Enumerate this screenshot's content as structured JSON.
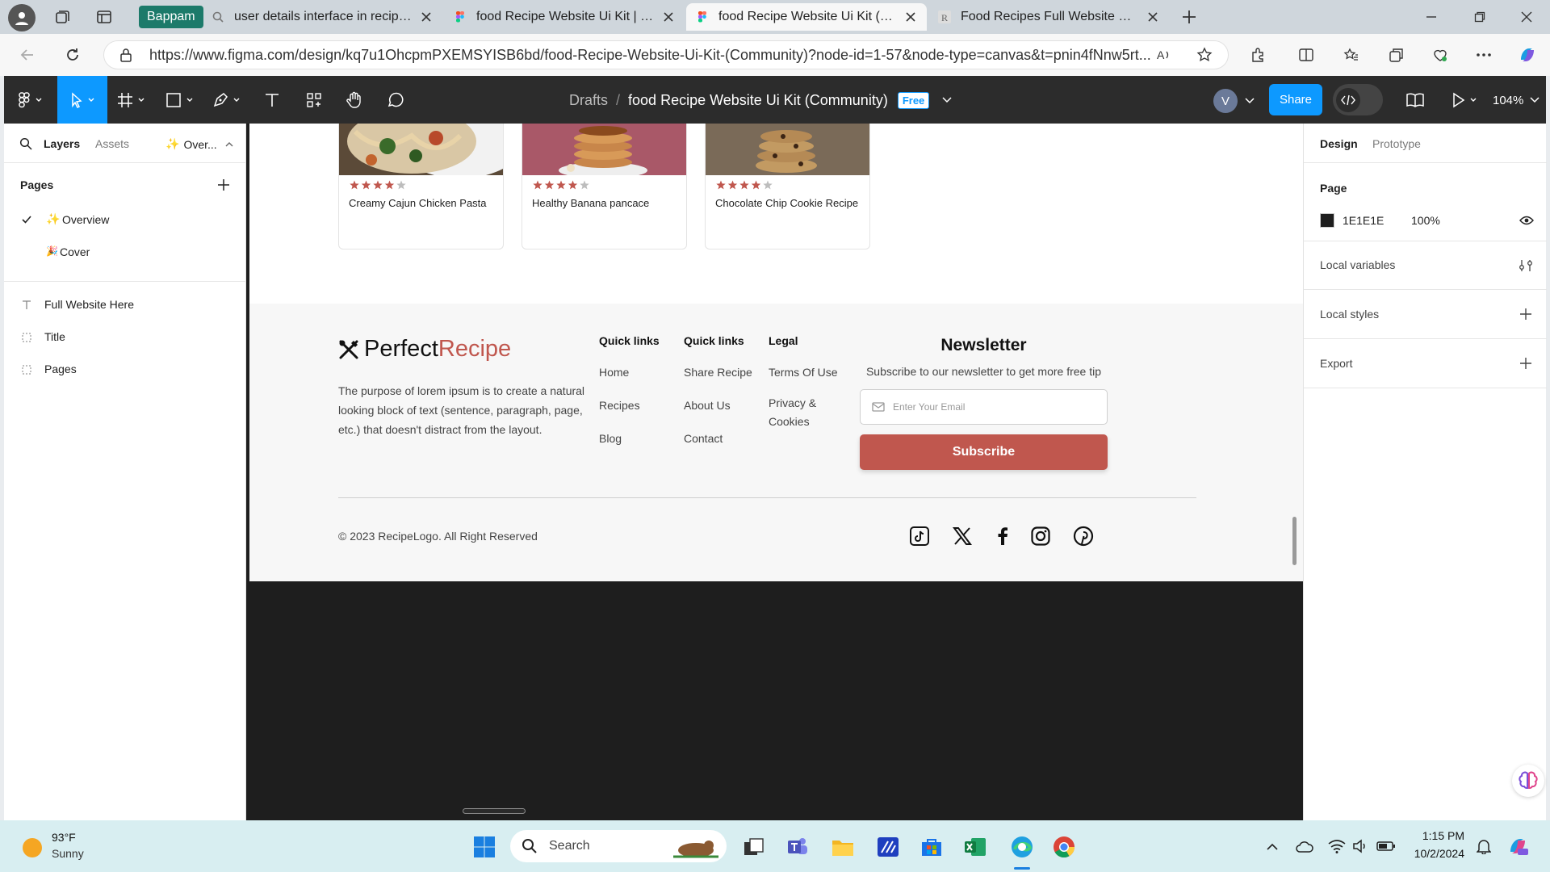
{
  "browser": {
    "tabs": [
      {
        "label": "Bappam",
        "kind": "group"
      },
      {
        "label": "user details interface in recipe we",
        "icon": "search-icon"
      },
      {
        "label": "food Recipe Website Ui Kit | Figma",
        "icon": "figma-icon"
      },
      {
        "label": "food Recipe Website Ui Kit (Comm",
        "icon": "figma-icon",
        "active": true
      },
      {
        "label": "Food Recipes Full Website UI Kit F",
        "icon": "r-icon"
      }
    ],
    "url": "https://www.figma.com/design/kq7u1OhcpmPXEMSYISB6bd/food-Recipe-Website-Ui-Kit-(Community)?node-id=1-57&node-type=canvas&t=pnin4fNnw5rt..."
  },
  "figma": {
    "breadcrumb_root": "Drafts",
    "file_title": "food Recipe Website Ui Kit (Community)",
    "badge": "Free",
    "avatar": "V",
    "share_label": "Share",
    "zoom": "104%"
  },
  "left_panel": {
    "tabs": {
      "layers": "Layers",
      "assets": "Assets",
      "page_switch": "Over..."
    },
    "pages_heading": "Pages",
    "pages": [
      {
        "label": "Overview",
        "emoji": "✨",
        "selected": true
      },
      {
        "label": "Cover",
        "emoji": "🎉",
        "selected": false
      }
    ],
    "layers": [
      {
        "label": "Full Website Here",
        "type": "text"
      },
      {
        "label": "Title",
        "type": "frame"
      },
      {
        "label": "Pages",
        "type": "frame"
      }
    ]
  },
  "right_panel": {
    "tabs": {
      "design": "Design",
      "prototype": "Prototype"
    },
    "page_heading": "Page",
    "bg_hex": "1E1E1E",
    "bg_color": "#1E1E1E",
    "bg_opacity": "100%",
    "sections": [
      "Local variables",
      "Local styles",
      "Export"
    ]
  },
  "design": {
    "recipes": [
      {
        "title": "Creamy Cajun Chicken Pasta",
        "rating": 4
      },
      {
        "title": "Healthy Banana pancace",
        "rating": 4
      },
      {
        "title": "Chocolate Chip Cookie Recipe",
        "rating": 4
      }
    ],
    "logo_a": "Perfect",
    "logo_b": "Recipe",
    "brand_color": "#C0574E",
    "description": "The purpose of lorem ipsum is to create a natural looking block of text (sentence, paragraph, page, etc.) that doesn't distract from the layout.",
    "columns": [
      {
        "heading": "Quick links",
        "links": [
          "Home",
          "Recipes",
          "Blog"
        ]
      },
      {
        "heading": "Quick links",
        "links": [
          "Share Recipe",
          "About Us",
          "Contact"
        ]
      },
      {
        "heading": "Legal",
        "links": [
          "Terms Of Use",
          "Privacy & Cookies"
        ]
      }
    ],
    "newsletter": {
      "title": "Newsletter",
      "subtitle": "Subscribe to our newsletter to get more free tip",
      "placeholder": "Enter Your Email",
      "button": "Subscribe"
    },
    "copyright": "© 2023 RecipeLogo. All Right Reserved",
    "social": [
      "tiktok-icon",
      "x-icon",
      "facebook-icon",
      "instagram-icon",
      "pinterest-icon"
    ]
  },
  "taskbar": {
    "temp": "93°F",
    "weather": "Sunny",
    "search": "Search",
    "time": "1:15 PM",
    "date": "10/2/2024"
  }
}
